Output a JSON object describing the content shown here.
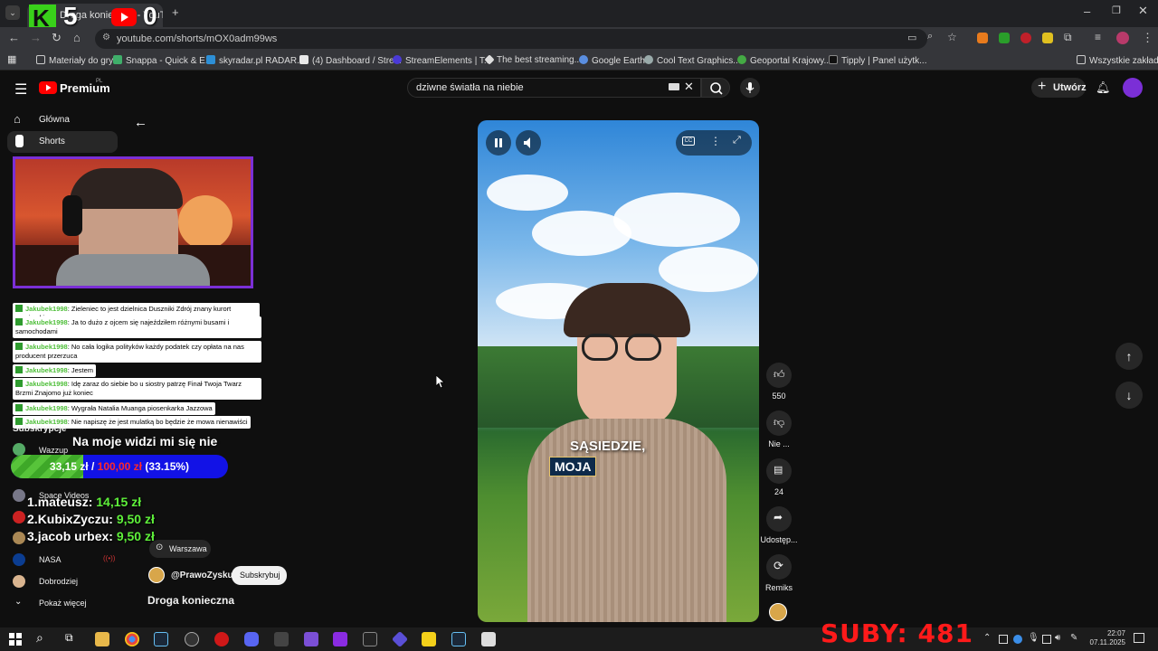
{
  "browser": {
    "tab_title": "Droga konieczna - YouTube",
    "url": "youtube.com/shorts/mOX0adm99ws",
    "bookmarks": [
      "Materiały do gry",
      "Snappa - Quick & E...",
      "skyradar.pl RADAR...",
      "(4) Dashboard / Stre...",
      "StreamElements | T...",
      "The best streaming...",
      "Google Earth",
      "Cool Text Graphics...",
      "Geoportal Krajowy...",
      "Tipply | Panel użytk..."
    ],
    "all_bookmarks": "Wszystkie zakładki"
  },
  "overlay_logo": {
    "letter": "K",
    "digits_left": "5",
    "digits_right": "0"
  },
  "youtube": {
    "logo": "Premium",
    "logo_badge": "PL",
    "search_query": "dziwne światła na niebie",
    "create_label": "Utwórz",
    "nav": [
      {
        "label": "Główna"
      },
      {
        "label": "Shorts"
      }
    ],
    "subscriptions_label": "Subskrypcje",
    "subs": [
      {
        "label": "Wazzup"
      },
      {
        "label": "Space Videos"
      },
      {
        "label": ""
      },
      {
        "label": ""
      },
      {
        "label": "NASA"
      },
      {
        "label": "Dobrodziej"
      }
    ],
    "show_more": "Pokaż więcej",
    "location": "Warszawa",
    "channel": "@PrawoZysku",
    "subscribe": "Subskrybuj",
    "short_title": "Droga konieczna",
    "likes": "550",
    "dislike": "Nie ...",
    "comments": "24",
    "share": "Udostęp...",
    "remix": "Remiks",
    "caption_line1": "SĄSIEDZIE,",
    "caption_line2": "MOJA"
  },
  "chat": [
    {
      "user": "Jakubek1998",
      "msg": ": Zieleniec to jest dzielnica Duszniki Zdrój znany kurort narciarski"
    },
    {
      "user": "Jakubek1998",
      "msg": ": Ja to dużo z ojcem się najeździłem różnymi busami i samochodami"
    },
    {
      "user": "Jakubek1998",
      "msg": ": No cała logika polityków każdy podatek czy opłata na nas producent przerzuca"
    },
    {
      "user": "Jakubek1998",
      "msg": ": Jestem"
    },
    {
      "user": "Jakubek1998",
      "msg": ": Idę zaraz do siebie bo u siostry patrzę Finał Twoja Twarz Brzmi Znajomo już koniec"
    },
    {
      "user": "Jakubek1998",
      "msg": ": Wygrała Natalia Muanga piosenkarka Jazzowa"
    },
    {
      "user": "Jakubek1998",
      "msg": ": Nie napiszę że jest mulatką bo będzie że mowa nienawiści"
    }
  ],
  "goal": {
    "title": "Na moje widzi mi się nie",
    "current": "33,15 zł /",
    "target": "100,00 zł",
    "percent_label": "(33.15%)",
    "fraction": 0.3315
  },
  "donors": [
    {
      "rank": "1.",
      "name": "mateusz:",
      "amount": "14,15 zł"
    },
    {
      "rank": "2.",
      "name": "KubixZyczu:",
      "amount": "9,50 zł"
    },
    {
      "rank": "3.",
      "name": "jacob urbex:",
      "amount": "9,50 zł"
    }
  ],
  "suby": "SUBY: 481",
  "clock": {
    "time": "22:07",
    "date": "07.11.2025"
  }
}
